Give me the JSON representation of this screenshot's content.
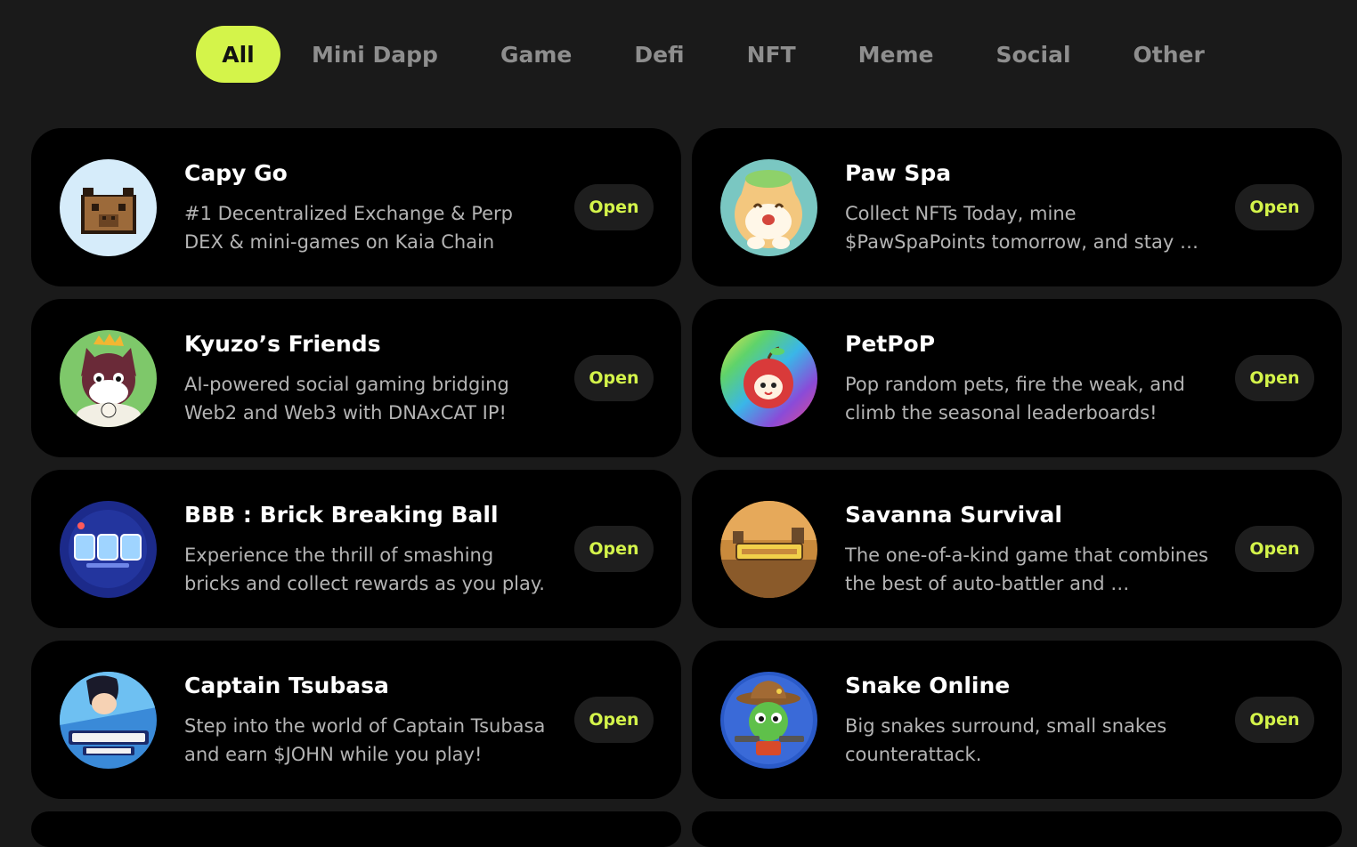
{
  "tabs": [
    {
      "label": "All",
      "active": true
    },
    {
      "label": "Mini Dapp"
    },
    {
      "label": "Game"
    },
    {
      "label": "Defi"
    },
    {
      "label": "NFT"
    },
    {
      "label": "Meme"
    },
    {
      "label": "Social"
    },
    {
      "label": "Other"
    }
  ],
  "colors": {
    "accent": "#d4f44a",
    "background": "#1a1a1a",
    "card": "#000000"
  },
  "apps": [
    {
      "name": "Capy Go",
      "description": "#1 Decentralized Exchange & Perp DEX & mini-games on Kaia Chain",
      "action": "Open",
      "icon": "capybara-icon"
    },
    {
      "name": "Paw Spa",
      "description": "Collect NFTs Today, mine $PawSpaPoints tomorrow, and stay …",
      "action": "Open",
      "icon": "cat-icon"
    },
    {
      "name": "Kyuzo’s Friends",
      "description": "AI-powered social gaming bridging Web2 and Web3 with DNAxCAT IP!",
      "action": "Open",
      "icon": "crowned-cat-icon"
    },
    {
      "name": "PetPoP",
      "description": "Pop random pets, fire the weak, and climb the seasonal leaderboards!",
      "action": "Open",
      "icon": "apple-pet-icon"
    },
    {
      "name": "BBB : Brick Breaking Ball",
      "description": "Experience the thrill of smashing bricks and collect rewards as you play.",
      "action": "Open",
      "icon": "bbb-logo-icon"
    },
    {
      "name": "Savanna Survival",
      "description": "The one-of-a-kind game that combines the best of auto-battler and …",
      "action": "Open",
      "icon": "savanna-logo-icon"
    },
    {
      "name": "Captain Tsubasa",
      "description": "Step into the world of Captain Tsubasa and earn $JOHN while you play!",
      "action": "Open",
      "icon": "tsubasa-logo-icon"
    },
    {
      "name": "Snake Online",
      "description": "Big snakes surround, small snakes counterattack.",
      "action": "Open",
      "icon": "snake-cowboy-icon"
    }
  ]
}
